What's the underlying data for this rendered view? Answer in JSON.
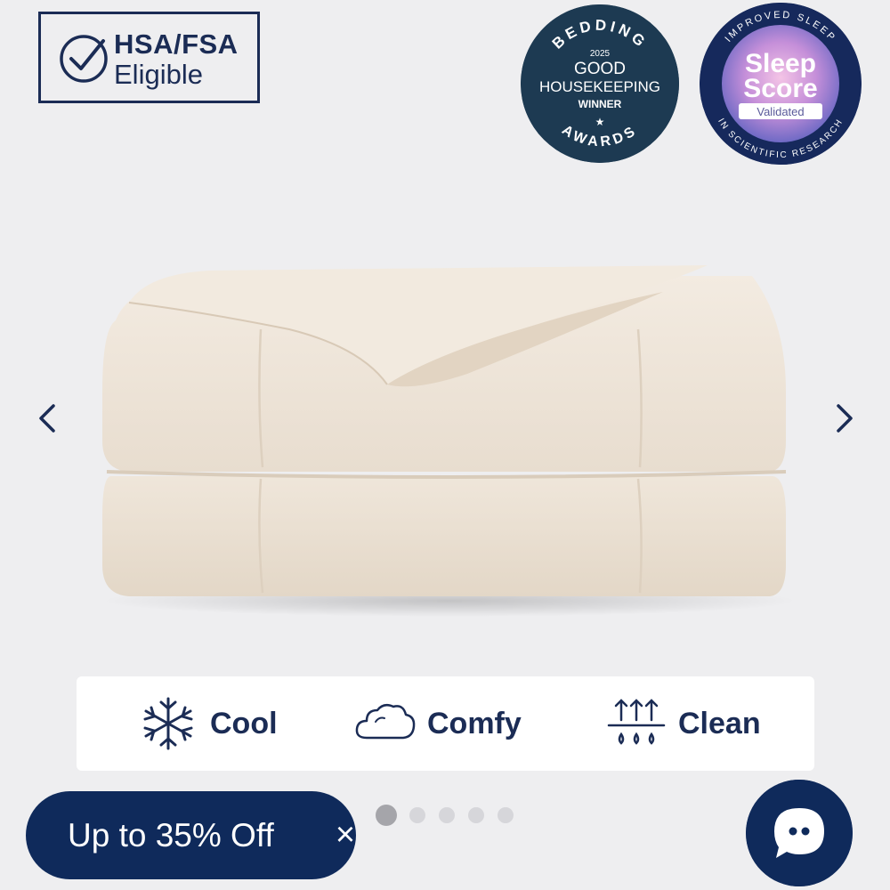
{
  "hsa_badge": {
    "line1": "HSA/FSA",
    "line2": "Eligible",
    "icon": "checkmark-circle-icon"
  },
  "awards": {
    "good_housekeeping": {
      "top_arc": "BEDDING",
      "year": "2025",
      "line1": "GOOD",
      "line2": "HOUSEKEEPING",
      "line3": "WINNER",
      "star": "★",
      "bottom_arc": "AWARDS"
    },
    "sleep_score": {
      "top_arc": "IMPROVED SLEEP",
      "line1": "Sleep",
      "line2": "Score",
      "validated": "Validated",
      "bottom_arc": "IN SCIENTIFIC RESEARCH"
    }
  },
  "carousel": {
    "prev_icon": "chevron-left-icon",
    "next_icon": "chevron-right-icon",
    "slide_count": 5,
    "active_index": 0
  },
  "features": [
    {
      "label": "Cool",
      "icon": "snowflake-icon"
    },
    {
      "label": "Comfy",
      "icon": "cloud-icon"
    },
    {
      "label": "Clean",
      "icon": "moisture-wicking-icon"
    }
  ],
  "promo": {
    "label": "Up to 35% Off",
    "close_glyph": "×"
  },
  "chat": {
    "icon": "chat-bubble-icon"
  },
  "colors": {
    "navy": "#1b2c55",
    "promo_navy": "#0f2a5b",
    "background": "#eeeef0",
    "product": "#efe6da"
  }
}
